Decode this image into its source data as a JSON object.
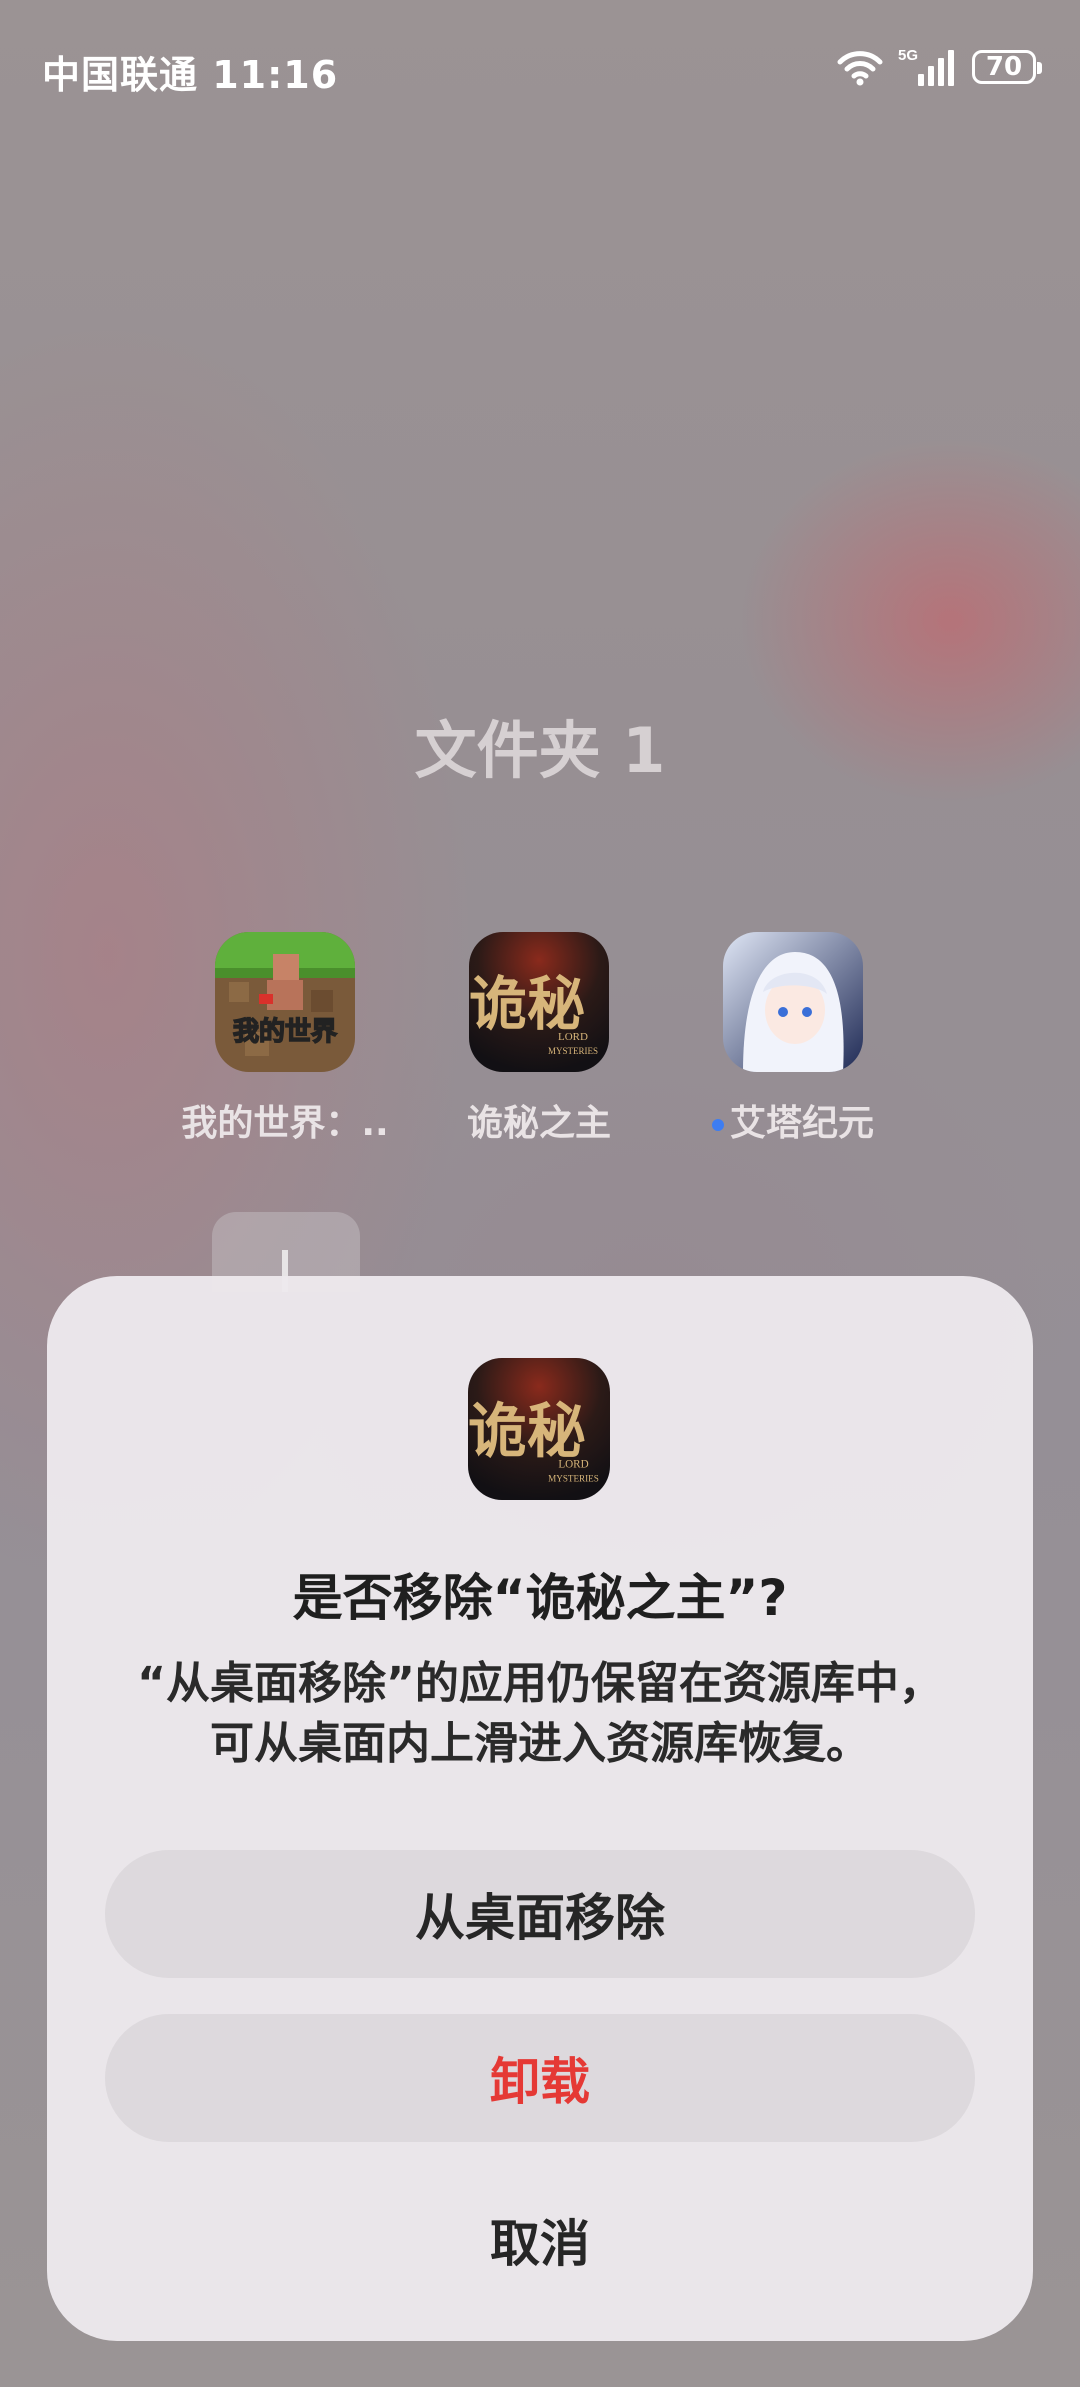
{
  "status_bar": {
    "carrier_time": "中国联通 11:16",
    "network": "5G",
    "battery": "70"
  },
  "folder": {
    "title": "文件夹 1",
    "apps": [
      {
        "label": "我的世界：..",
        "icon": "minecraft-icon"
      },
      {
        "label": "诡秘之主",
        "icon": "lord-of-mysteries-icon"
      },
      {
        "label": "艾塔纪元",
        "icon": "aita-era-icon",
        "new_dot": true
      }
    ]
  },
  "dialog": {
    "app_icon": "lord-of-mysteries-icon",
    "title": "是否移除“诡秘之主”?",
    "message_line1": "“从桌面移除”的应用仍保留在资源库中，",
    "message_line2": "可从桌面内上滑进入资源库恢复。",
    "remove_label": "从桌面移除",
    "uninstall_label": "卸载",
    "cancel_label": "取消"
  },
  "colors": {
    "uninstall": "#e53935",
    "new_dot": "#3d7df2"
  }
}
